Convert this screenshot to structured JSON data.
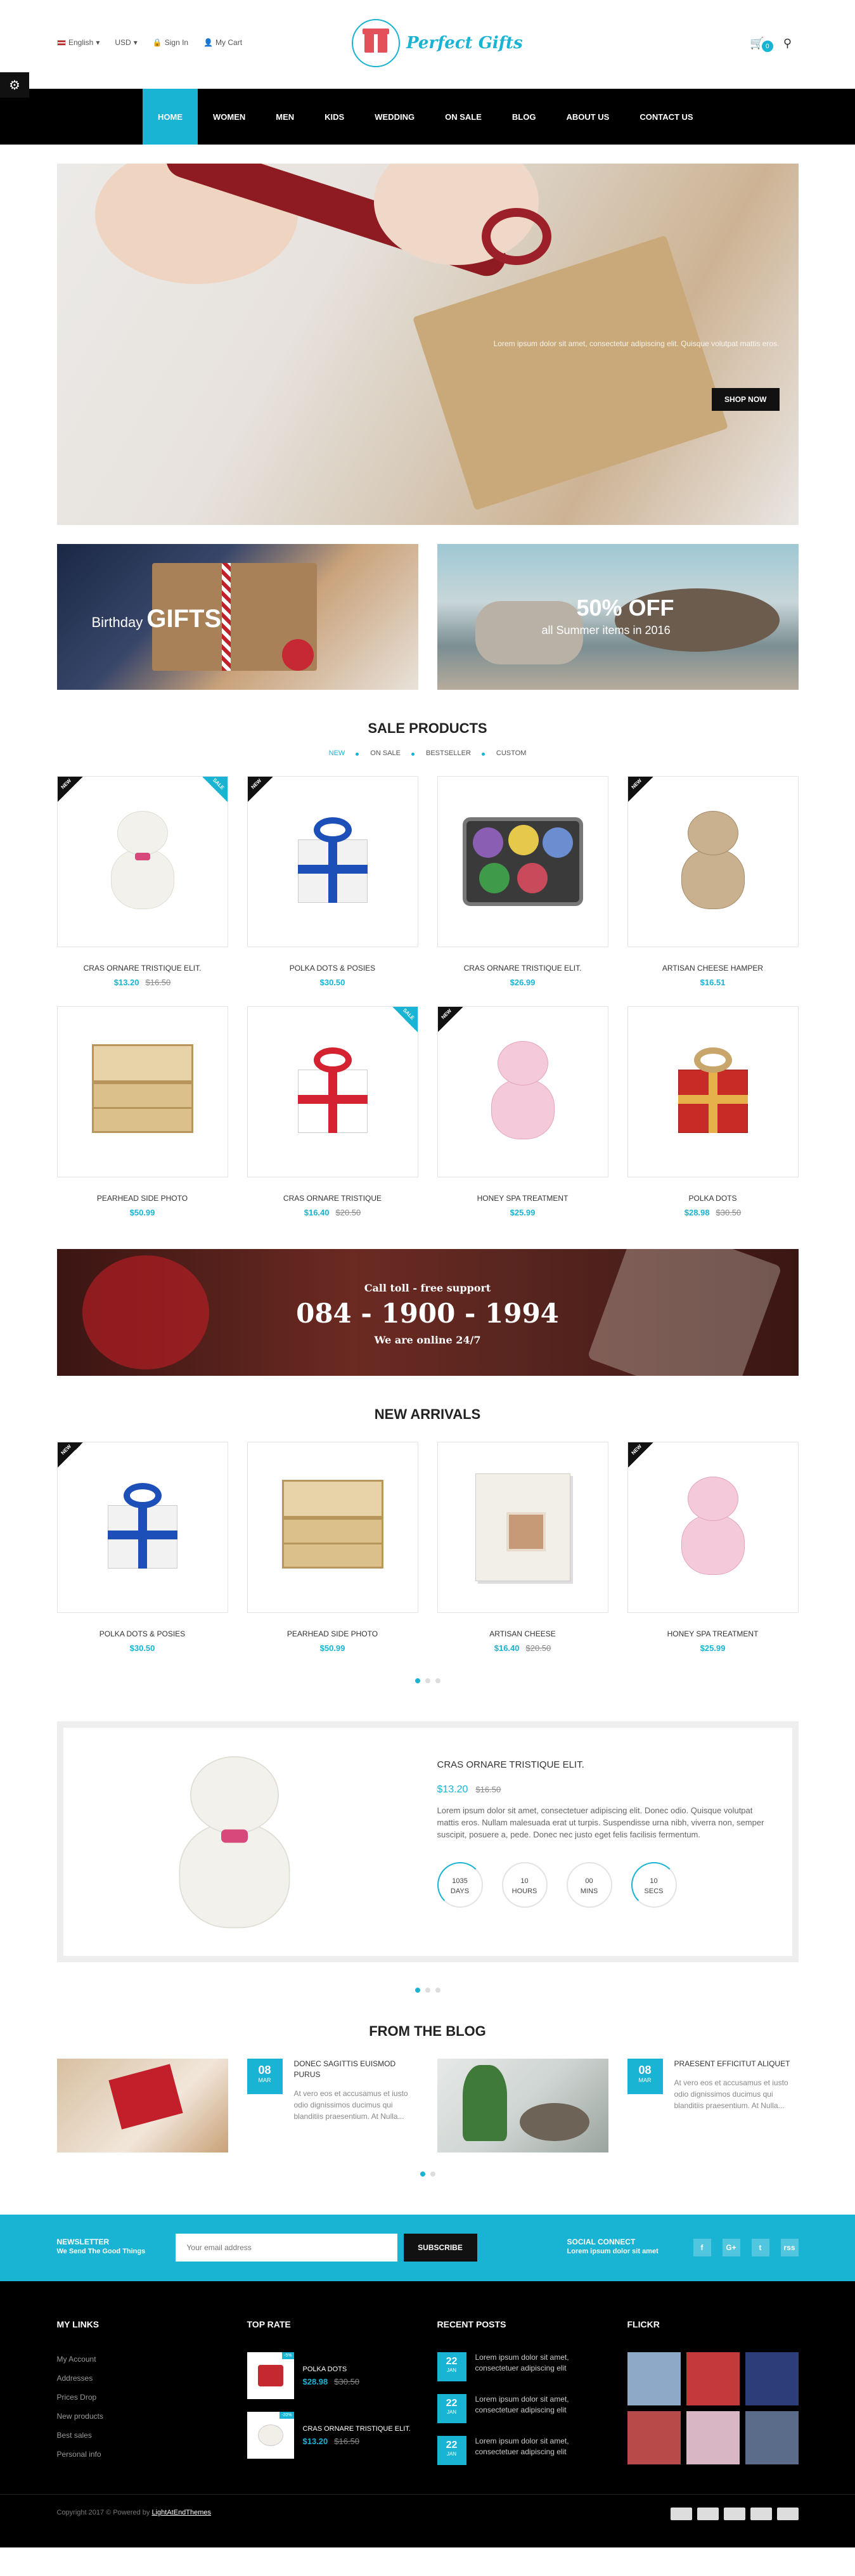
{
  "topbar": {
    "language": "English",
    "currency": "USD",
    "signin": "Sign In",
    "mycart": "My Cart",
    "logo_text": "Perfect Gifts",
    "cart_count": "0"
  },
  "nav": [
    "Home",
    "Women",
    "Men",
    "Kids",
    "Wedding",
    "On Sale",
    "Blog",
    "About Us",
    "Contact Us"
  ],
  "hero": {
    "caption": "Lorem ipsum dolor sit amet, consectetur adipiscing elit. Quisque volutpat mattis eros.",
    "button": "Shop Now"
  },
  "banners": {
    "b1_small": "Birthday",
    "b1_big": "GIFTS",
    "b2_big": "50% OFF",
    "b2_small": "all Summer items in 2016"
  },
  "sale": {
    "title": "Sale Products",
    "tabs": [
      "New",
      "On Sale",
      "Bestseller",
      "Custom"
    ],
    "products": [
      {
        "name": "Cras Ornare Tristique Elit.",
        "price": "$13.20",
        "old": "$16.50",
        "tags": [
          "new",
          "sale"
        ]
      },
      {
        "name": "Polka Dots & Posies",
        "price": "$30.50",
        "old": "",
        "tags": [
          "new"
        ]
      },
      {
        "name": "Cras Ornare Tristique Elit.",
        "price": "$26.99",
        "old": "",
        "tags": []
      },
      {
        "name": "Artisan Cheese Hamper",
        "price": "$16.51",
        "old": "",
        "tags": [
          "new"
        ]
      },
      {
        "name": "Pearhead Side Photo",
        "price": "$50.99",
        "old": "",
        "tags": []
      },
      {
        "name": "Cras Ornare Tristique",
        "price": "$16.40",
        "old": "$20.50",
        "tags": [
          "sale"
        ]
      },
      {
        "name": "Honey Spa Treatment",
        "price": "$25.99",
        "old": "",
        "tags": [
          "new"
        ]
      },
      {
        "name": "Polka Dots",
        "price": "$28.98",
        "old": "$30.50",
        "tags": []
      }
    ]
  },
  "callbar": {
    "line1": "Call toll - free support",
    "phone": "084 - 1900 - 1994",
    "line3": "We are online 24/7"
  },
  "arrivals": {
    "title": "New Arrivals",
    "products": [
      {
        "name": "Polka Dots & Posies",
        "price": "$30.50",
        "old": "",
        "tags": [
          "new"
        ]
      },
      {
        "name": "Pearhead Side Photo",
        "price": "$50.99",
        "old": "",
        "tags": []
      },
      {
        "name": "Artisan Cheese",
        "price": "$16.40",
        "old": "$20.50",
        "tags": []
      },
      {
        "name": "Honey Spa Treatment",
        "price": "$25.99",
        "old": "",
        "tags": [
          "new"
        ]
      }
    ]
  },
  "deal": {
    "name": "Cras Ornare Tristique Elit.",
    "price": "$13.20",
    "old": "$16.50",
    "desc": "Lorem ipsum dolor sit amet, consectetuer adipiscing elit. Donec odio. Quisque volutpat mattis eros. Nullam malesuada erat ut turpis. Suspendisse urna nibh, viverra non, semper suscipit, posuere a, pede. Donec nec justo eget felis facilisis fermentum.",
    "timer": [
      {
        "value": "1035",
        "unit": "Days"
      },
      {
        "value": "10",
        "unit": "Hours"
      },
      {
        "value": "00",
        "unit": "Mins"
      },
      {
        "value": "10",
        "unit": "Secs"
      }
    ]
  },
  "blog": {
    "title": "From The Blog",
    "posts": [
      {
        "day": "08",
        "month": "Mar",
        "title": "Donec sagittis euismod purus",
        "excerpt": "At vero eos et accusamus et iusto odio dignissimos ducimus qui blanditiis praesentium. At Nulla..."
      },
      {
        "day": "08",
        "month": "Mar",
        "title": "Praesent efficitut aliquet",
        "excerpt": "At vero eos et accusamus et iusto odio dignissimos ducimus qui blanditiis praesentium. At Nulla..."
      }
    ]
  },
  "newsletter": {
    "title": "Newsletter",
    "subtitle": "We Send The Good Things",
    "placeholder": "Your email address",
    "button": "Subscribe",
    "social_title": "Social Connect",
    "social_sub": "Lorem ipsum dolor sit amet",
    "socials": [
      "f",
      "G+",
      "t",
      "rss"
    ]
  },
  "footer": {
    "links_title": "My Links",
    "links": [
      "My Account",
      "Addresses",
      "Prices Drop",
      "New products",
      "Best sales",
      "Personal info"
    ],
    "toprate_title": "Top Rate",
    "toprate": [
      {
        "name": "Polka Dots",
        "price": "$28.98",
        "old": "$30.50",
        "tag": "-5%"
      },
      {
        "name": "Cras Ornare Tristique Elit.",
        "price": "$13.20",
        "old": "$16.50",
        "tag": "-20%"
      }
    ],
    "recent_title": "Recent Posts",
    "recent": [
      {
        "day": "22",
        "month": "Jan",
        "text": "Lorem ipsum dolor sit amet, consectetuer adipiscing elit"
      },
      {
        "day": "22",
        "month": "Jan",
        "text": "Lorem ipsum dolor sit amet, consectetuer adipiscing elit"
      },
      {
        "day": "22",
        "month": "Jan",
        "text": "Lorem ipsum dolor sit amet, consectetuer adipiscing elit"
      }
    ],
    "flickr_title": "Flickr",
    "copyright": "Copyright 2017 © Powered by",
    "copyright_link": "LightAtEndThemes"
  },
  "colors": {
    "accent": "#19b3d3",
    "dark": "#000000"
  }
}
